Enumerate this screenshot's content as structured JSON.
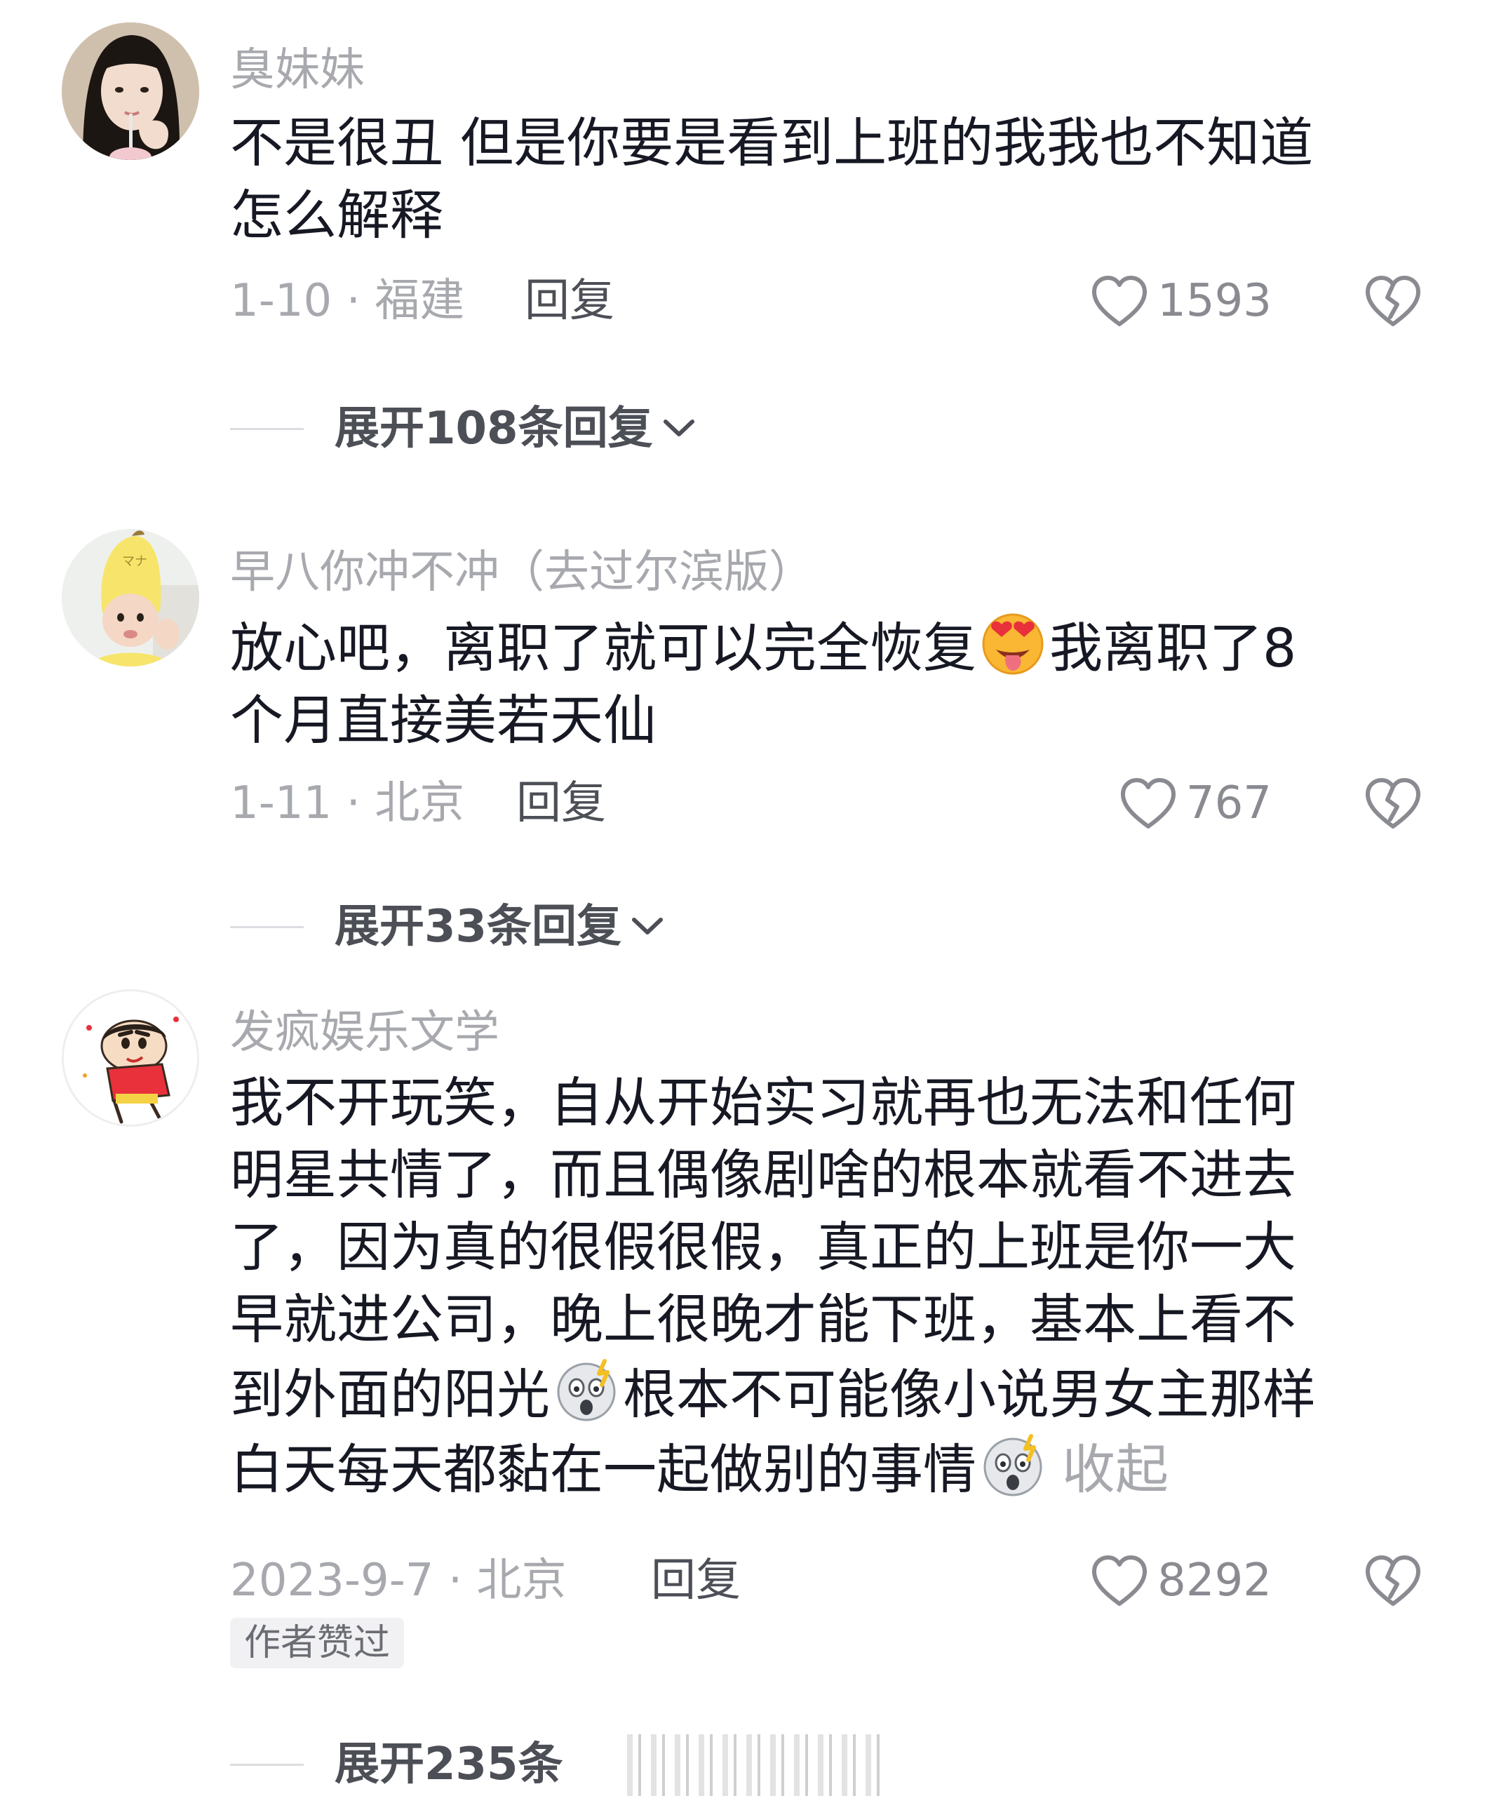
{
  "comments": [
    {
      "username": "臭妹妹",
      "body_lines": [
        "不是很丑 但是你要是看到上班的我我也不知道",
        "怎么解释"
      ],
      "date_location": "1-10 · 福建",
      "reply_label": "回复",
      "likes": "1593",
      "avatar": "girl-photo-avatar",
      "expand": "展开108条回复"
    },
    {
      "username": "早八你冲不冲（去过尔滨版）",
      "body_lines": [
        "放心吧，离职了就可以完全恢复",
        "我离职了8",
        "个月直接美若天仙"
      ],
      "emoji": "star-struck-tongue-emoji",
      "date_location": "1-11 · 北京",
      "reply_label": "回复",
      "likes": "767",
      "avatar": "baby-in-banana-hat-avatar",
      "expand": "展开33条回复"
    },
    {
      "username": "发疯娱乐文学",
      "body_lines": [
        "我不开玩笑，自从开始实习就再也无法和任何",
        "明星共情了，而且偶像剧啥的根本就看不进去",
        "了，因为真的很假很假，真正的上班是你一大",
        "早就进公司，晚上很晚才能下班，基本上看不",
        "到外面的阳光",
        "根本不可能像小说男女主那样",
        "白天每天都黏在一起做别的事情"
      ],
      "emoji": "shocked-face-emoji",
      "collapse_label": "收起",
      "date_location": "2023-9-7 · 北京",
      "reply_label": "回复",
      "likes": "8292",
      "badge": "作者赞过",
      "avatar": "crayon-shin-chan-avatar",
      "expand": "展开235条"
    }
  ],
  "icons": {
    "like": "heart-outline-icon",
    "dislike": "broken-heart-icon",
    "expand": "chevron-down-icon"
  },
  "colors": {
    "text_primary": "#161823",
    "text_secondary": "#a7a9ae",
    "action": "#4d4f57"
  }
}
